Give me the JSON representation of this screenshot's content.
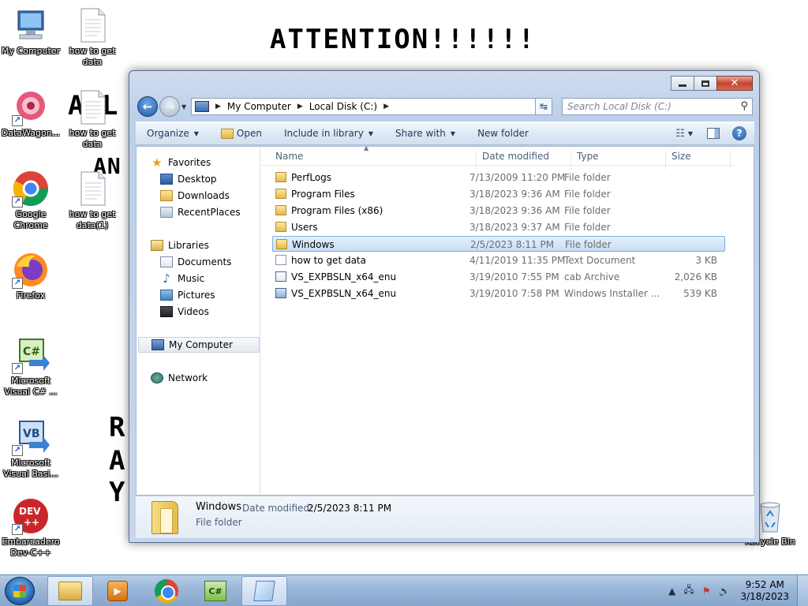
{
  "desktop": {
    "banner": "ATTENTION!!!!!!",
    "fragments": [
      "A L",
      "AN",
      "R",
      "A",
      "Y"
    ],
    "icons": [
      {
        "label": "My Computer"
      },
      {
        "label": "how to get data"
      },
      {
        "label": "DataWagon..."
      },
      {
        "label": "how to get data"
      },
      {
        "label": "Google Chrome"
      },
      {
        "label": "how to get data(1)"
      },
      {
        "label": "Firefox"
      },
      {
        "label": "Microsoft Visual C# ..."
      },
      {
        "label": "Microsoft Visual Basi..."
      },
      {
        "label": "Embarcadero Dev-C++"
      },
      {
        "label": "Recycle Bin"
      }
    ]
  },
  "window": {
    "address": {
      "crumbs": [
        "My Computer",
        "Local Disk (C:)"
      ]
    },
    "search": {
      "placeholder": "Search Local Disk (C:)"
    },
    "toolbar": {
      "organize": "Organize",
      "open": "Open",
      "include": "Include in library",
      "share": "Share with",
      "newfolder": "New folder"
    },
    "nav": {
      "favorites": "Favorites",
      "desktop": "Desktop",
      "downloads": "Downloads",
      "recentplaces": "RecentPlaces",
      "libraries": "Libraries",
      "documents": "Documents",
      "music": "Music",
      "pictures": "Pictures",
      "videos": "Videos",
      "mycomputer": "My Computer",
      "network": "Network"
    },
    "columns": {
      "name": "Name",
      "date": "Date modified",
      "type": "Type",
      "size": "Size"
    },
    "files": [
      {
        "name": "PerfLogs",
        "date": "7/13/2009 11:20 PM",
        "type": "File folder",
        "size": ""
      },
      {
        "name": "Program Files",
        "date": "3/18/2023 9:36 AM",
        "type": "File folder",
        "size": ""
      },
      {
        "name": "Program Files (x86)",
        "date": "3/18/2023 9:36 AM",
        "type": "File folder",
        "size": ""
      },
      {
        "name": "Users",
        "date": "3/18/2023 9:37 AM",
        "type": "File folder",
        "size": ""
      },
      {
        "name": "Windows",
        "date": "2/5/2023 8:11 PM",
        "type": "File folder",
        "size": ""
      },
      {
        "name": "how to get data",
        "date": "4/11/2019 11:35 PM",
        "type": "Text Document",
        "size": "3 KB"
      },
      {
        "name": "VS_EXPBSLN_x64_enu",
        "date": "3/19/2010 7:55 PM",
        "type": "cab Archive",
        "size": "2,026 KB"
      },
      {
        "name": "VS_EXPBSLN_x64_enu",
        "date": "3/19/2010 7:58 PM",
        "type": "Windows Installer ...",
        "size": "539 KB"
      }
    ],
    "details": {
      "name": "Windows",
      "modified_label": "Date modified:",
      "modified_value": "2/5/2023 8:11 PM",
      "type": "File folder"
    }
  },
  "taskbar": {
    "time": "9:52 AM",
    "date": "3/18/2023",
    "apps": [
      "explorer-icon",
      "media-icon",
      "chrome-icon",
      "csharp-icon",
      "notepad-icon"
    ]
  }
}
